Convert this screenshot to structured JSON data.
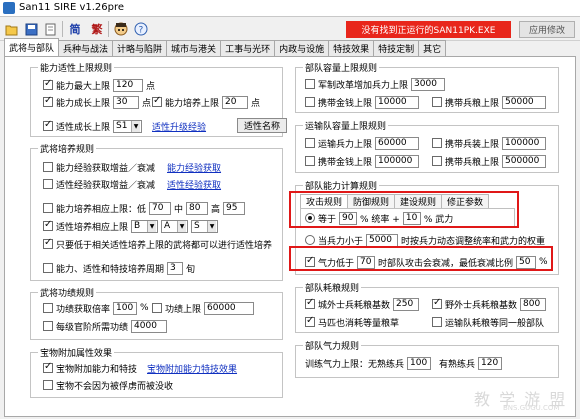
{
  "window": {
    "title": "San11 SIRE v1.26pre"
  },
  "toolbar": {
    "simplified": "简",
    "traditional": "繁",
    "warning": "没有找到正运行的SAN11PK.EXE",
    "apply": "应用修改"
  },
  "tabs": [
    "武将与部队",
    "兵种与战法",
    "计略与陷阱",
    "城市与港关",
    "工事与光环",
    "内政与设施",
    "特技效果",
    "特技定制",
    "其它"
  ],
  "ability_limit": {
    "legend": "能力适性上限规则",
    "max_limit": {
      "label": "能力最大上限",
      "value": "120",
      "unit": "点",
      "checked": true
    },
    "growth_limit": {
      "label": "能力成长上限",
      "value": "30",
      "unit": "点",
      "checked": true
    },
    "train_limit": {
      "label": "能力培养上限",
      "value": "20",
      "unit": "点",
      "checked": true
    },
    "aptitude_limit": {
      "label": "适性成长上限",
      "select": "S1",
      "link": "适性升级经验",
      "button": "适性名称",
      "checked": true
    }
  },
  "training": {
    "legend": "武将培养规则",
    "exp_increase": {
      "label": "能力经验获取增益／衰减",
      "link": "能力经验获取",
      "checked": false
    },
    "apt_exp_increase": {
      "label": "适性经验获取增益／衰减",
      "link": "适性经验获取",
      "checked": false
    },
    "train_limit_row": {
      "label": "能力培养相应上限：低",
      "low": "70",
      "mid_label": "中",
      "mid": "80",
      "high_label": "高",
      "high": "95",
      "checked": false
    },
    "apt_train_row": {
      "label": "适性培养相应上限",
      "sel_b": "B",
      "sel_a": "A",
      "sel_s": "S",
      "checked": true
    },
    "only_below": {
      "label": "只要低于相关适性培养上限的武将都可以进行适性培养",
      "checked": true
    },
    "period": {
      "label": "能力、适性和特技培养周期",
      "value": "3",
      "unit": "旬",
      "checked": false
    }
  },
  "merit": {
    "legend": "武将功绩规则",
    "merit_rate": {
      "label": "功绩获取倍率",
      "value": "100",
      "unit": "%",
      "checked": false
    },
    "merit_limit": {
      "label": "功绩上限",
      "value": "60000",
      "checked": false
    },
    "rank_merit": {
      "label": "每级官阶所需功绩",
      "value": "4000",
      "checked": false
    }
  },
  "treasure": {
    "legend": "宝物附加属性效果",
    "extra": {
      "label": "宝物附加能力和特技",
      "link": "宝物附加能力特技效果",
      "checked": true
    },
    "no_loss": {
      "label": "宝物不会因为被俘虏而被没收",
      "checked": false
    }
  },
  "unit_capacity": {
    "legend": "部队容量上限规则",
    "general_unit": {
      "label": "军制改革增加兵力上限",
      "value": "3000",
      "checked": false
    },
    "gold": {
      "label": "携带金钱上限",
      "value": "10000",
      "checked": false
    },
    "food": {
      "label": "携带兵粮上限",
      "value": "50000",
      "checked": false
    }
  },
  "transport": {
    "legend": "运输队容量上限规则",
    "troops": {
      "label": "运输兵力上限",
      "value": "60000",
      "checked": false
    },
    "weapons": {
      "label": "携带兵装上限",
      "value": "100000",
      "checked": false
    },
    "gold": {
      "label": "携带金钱上限",
      "value": "100000",
      "checked": false
    },
    "food": {
      "label": "携带兵粮上限",
      "value": "500000",
      "checked": false
    }
  },
  "calc": {
    "legend": "部队能力计算规则",
    "inner_tabs": [
      "攻击规则",
      "防御规则",
      "建设规则",
      "修正参数"
    ],
    "equal": {
      "label1": "等于",
      "v1": "90",
      "label2": "% 统率 +",
      "v2": "10",
      "label3": "% 武力",
      "selected": true
    },
    "less": {
      "label1": "当兵力小于",
      "value": "5000",
      "label2": "时按兵力动态调整统率和武力的权重",
      "selected": false
    },
    "low_morale": {
      "label1": "气力低于",
      "value": "70",
      "label2": "时部队攻击会衰减，最低衰减比例",
      "value2": "50",
      "unit": "%",
      "checked": true
    }
  },
  "consumption": {
    "legend": "部队耗粮规则",
    "city_base": {
      "label": "城外士兵耗粮基数",
      "value": "250",
      "checked": true
    },
    "field_base": {
      "label": "野外士兵耗粮基数",
      "value": "800",
      "checked": true
    },
    "horse": {
      "label": "马匹也消耗等量粮草",
      "checked": true
    },
    "transport": {
      "label": "运输队耗粮等同一般部队",
      "checked": false
    }
  },
  "morale": {
    "legend": "部队气力规则",
    "row": {
      "label1": "训练气力上限：无熟练兵",
      "v1": "100",
      "label2": "有熟练兵",
      "v2": "120"
    }
  },
  "watermark": {
    "text": "教 学 游 盟",
    "sub": "BNS.GUGU.COM"
  },
  "colors": {
    "warning": "#e8261b",
    "highlight": "#e01818",
    "link": "#1030c0"
  }
}
